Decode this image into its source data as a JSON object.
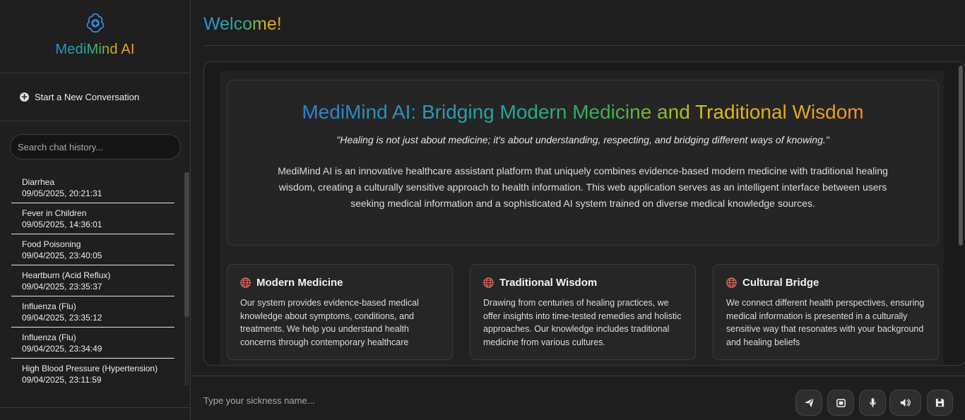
{
  "brand": {
    "name": "MediMind AI",
    "icon": "brain-medical-icon"
  },
  "sidebar": {
    "new_chat_label": "Start a New Conversation",
    "search_placeholder": "Search chat history...",
    "history": [
      {
        "title": "Diarrhea",
        "date": "09/05/2025, 20:21:31"
      },
      {
        "title": "Fever in Children",
        "date": "09/05/2025, 14:36:01"
      },
      {
        "title": "Food Poisoning",
        "date": "09/04/2025, 23:40:05"
      },
      {
        "title": "Heartburn (Acid Reflux)",
        "date": "09/04/2025, 23:35:37"
      },
      {
        "title": "Influenza (Flu)",
        "date": "09/04/2025, 23:35:12"
      },
      {
        "title": "Influenza (Flu)",
        "date": "09/04/2025, 23:34:49"
      },
      {
        "title": "High Blood Pressure (Hypertension)",
        "date": "09/04/2025, 23:11:59"
      }
    ]
  },
  "main": {
    "welcome": "Welcome!",
    "hero": {
      "title": "MediMind AI: Bridging Modern Medicine and Traditional Wisdom",
      "quote": "\"Healing is not just about medicine; it's about understanding, respecting, and bridging different ways of knowing.\"",
      "description": "MediMind AI is an innovative healthcare assistant platform that uniquely combines evidence-based modern medicine with traditional healing wisdom, creating a culturally sensitive approach to health information. This web application serves as an intelligent interface between users seeking medical information and a sophisticated AI system trained on diverse medical knowledge sources."
    },
    "cards": [
      {
        "title": "Modern Medicine",
        "text": "Our system provides evidence-based medical knowledge about symptoms, conditions, and treatments. We help you understand health concerns through contemporary healthcare"
      },
      {
        "title": "Traditional Wisdom",
        "text": "Drawing from centuries of healing practices, we offer insights into time-tested remedies and holistic approaches. Our knowledge includes traditional medicine from various cultures."
      },
      {
        "title": "Cultural Bridge",
        "text": "We connect different health perspectives, ensuring medical information is presented in a culturally sensitive way that resonates with your background and healing beliefs"
      }
    ]
  },
  "composer": {
    "placeholder": "Type your sickness name...",
    "buttons": [
      "send-icon",
      "image-upload-icon",
      "microphone-icon",
      "speaker-icon",
      "save-icon"
    ]
  },
  "colors": {
    "background": "#1e1e1e",
    "panel": "#252525",
    "accent_blue": "#2f8fd8",
    "accent_orange": "#f09a2a",
    "globe_red": "#e06a5a"
  }
}
